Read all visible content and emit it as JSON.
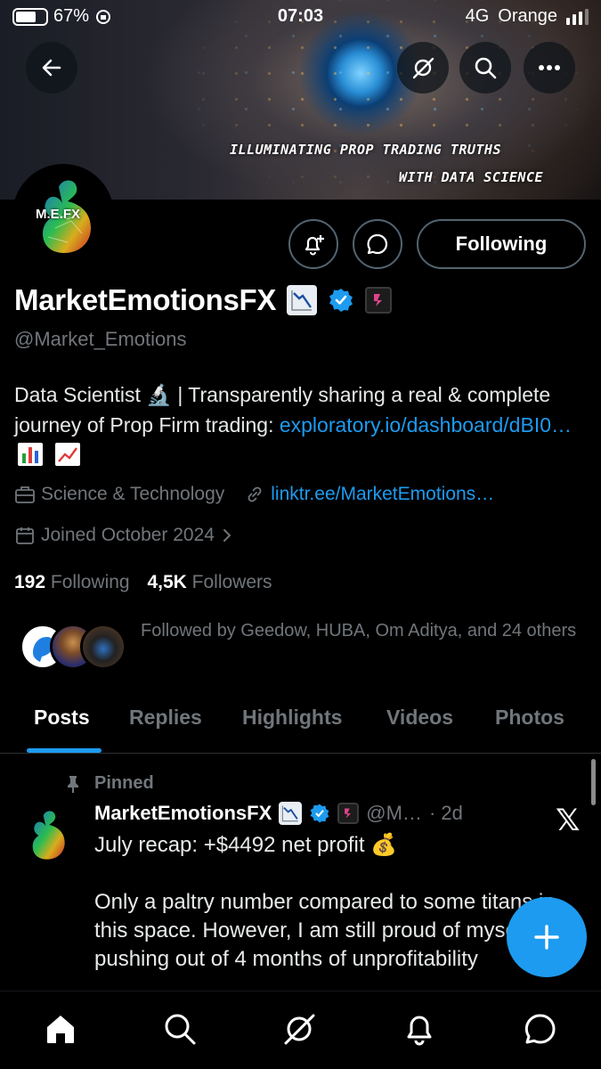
{
  "status_bar": {
    "battery": "67%",
    "time": "07:03",
    "network": "4G",
    "carrier": "Orange"
  },
  "banner": {
    "tagline_line1": "ILLUMINATING PROP TRADING TRUTHS",
    "tagline_line2": "WITH DATA SCIENCE"
  },
  "profile": {
    "avatar_text": "M.E.FX",
    "display_name": "MarketEmotionsFX",
    "name_emoji": "chart-decreasing-emoji",
    "handle": "@Market_Emotions",
    "following_button": "Following",
    "bio_text": "Data Scientist 🔬 | Transparently sharing a real & complete journey of Prop Firm trading: ",
    "bio_link": "exploratory.io/dashboard/dBI0…",
    "category": "Science & Technology",
    "website": "linktr.ee/MarketEmotions…",
    "joined": "Joined October 2024",
    "following_count": "192",
    "following_label": "Following",
    "followers_count": "4,5K",
    "followers_label": "Followers",
    "followed_by": "Followed by Geedow, HUBA, Om Aditya, and 24 others"
  },
  "tabs": [
    {
      "label": "Posts"
    },
    {
      "label": "Replies"
    },
    {
      "label": "Highlights"
    },
    {
      "label": "Videos"
    },
    {
      "label": "Photos"
    }
  ],
  "pinned_post": {
    "pinned_label": "Pinned",
    "author": "MarketEmotionsFX",
    "handle_truncated": "@M…",
    "time": "· 2d",
    "line1": "July recap: +$4492 net profit 💰",
    "para2": "Only a paltry number compared to some titans in this space. However, I am still proud of myself for pushing out of 4 months of unprofitability"
  },
  "colors": {
    "accent": "#1d9bf0",
    "muted": "#71767b",
    "background": "#000000"
  }
}
